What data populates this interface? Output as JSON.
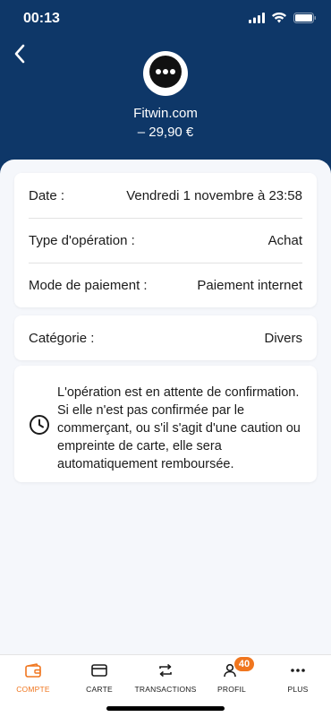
{
  "status_bar": {
    "time": "00:13"
  },
  "header": {
    "merchant_name": "Fitwin.com",
    "amount": "– 29,90 €"
  },
  "details": [
    {
      "label": "Date :",
      "value": "Vendredi 1 novembre à 23:58"
    },
    {
      "label": "Type d'opération :",
      "value": "Achat"
    },
    {
      "label": "Mode de paiement :",
      "value": "Paiement internet"
    }
  ],
  "category": {
    "label": "Catégorie :",
    "value": "Divers"
  },
  "info": {
    "text": "L'opération est en attente de confirmation. Si elle n'est pas confirmée par le commerçant, ou s'il s'agit d'une caution ou empreinte de carte, elle sera automatiquement remboursée."
  },
  "tabbar": {
    "tabs": [
      {
        "label": "COMPTE",
        "icon": "wallet-icon",
        "active": true
      },
      {
        "label": "CARTE",
        "icon": "card-icon",
        "active": false
      },
      {
        "label": "TRANSACTIONS",
        "icon": "transfer-icon",
        "active": false
      },
      {
        "label": "PROFIL",
        "icon": "profile-icon",
        "active": false
      },
      {
        "label": "PLUS",
        "icon": "more-icon",
        "active": false
      }
    ],
    "profile_badge": "40"
  },
  "colors": {
    "header_bg": "#0e3768",
    "accent": "#f0761f",
    "page_bg": "#f5f7fb"
  }
}
